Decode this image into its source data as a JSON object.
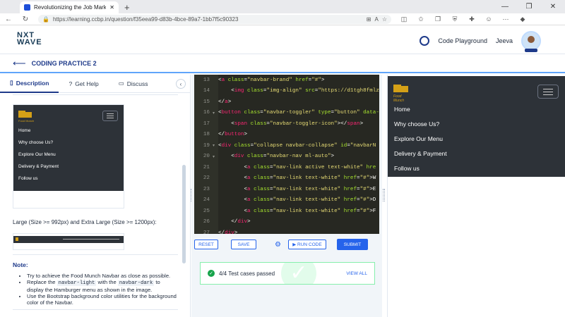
{
  "browser": {
    "tab_title": "Revolutionizing the Job Market |",
    "close_tab": "✕",
    "new_tab": "+",
    "url": "https://learning.ccbp.in/question/f35eea99-d83b-4bce-89a7-1bb7f5c90323",
    "window_controls": [
      "—",
      "❐",
      "✕"
    ]
  },
  "header": {
    "logo_line1": "NXT",
    "logo_line2": "WAVE",
    "code_playground": "Code Playground",
    "user_name": "Jeeva"
  },
  "subheader": {
    "title": "CODING PRACTICE 2"
  },
  "left_panel": {
    "tabs": [
      {
        "label": "Description"
      },
      {
        "label": "Get Help"
      },
      {
        "label": "Discuss"
      }
    ],
    "mock_nav": {
      "brand": "Food Munch",
      "links": [
        "Home",
        "Why choose Us?",
        "Explore Our Menu",
        "Delivery & Payment",
        "Follow us"
      ]
    },
    "large_text": "Large (Size >= 992px) and Extra Large (Size >= 1200px):",
    "note_heading": "Note:",
    "notes": {
      "n1": "Try to achieve the Food Munch Navbar as close as possible.",
      "n2_a": "Replace the",
      "n2_code1": "navbar-light",
      "n2_b": "with the",
      "n2_code2": "navbar-dark",
      "n2_c": "to display the Hamburger menu as shown in the image.",
      "n3": "Use the Bootstrap background color utilities for the background color of the Navbar."
    }
  },
  "editor": {
    "lines": [
      {
        "n": "13",
        "fold": "",
        "indent": "",
        "parts": [
          [
            "tk-txt",
            "<"
          ],
          [
            "tk-tag",
            "a "
          ],
          [
            "tk-attr",
            "class"
          ],
          [
            "tk-txt",
            "="
          ],
          [
            "tk-str",
            "\"navbar-brand\" "
          ],
          [
            "tk-attr",
            "href"
          ],
          [
            "tk-txt",
            "="
          ],
          [
            "tk-str",
            "\"#\""
          ],
          [
            "tk-txt",
            ">"
          ]
        ]
      },
      {
        "n": "14",
        "fold": "",
        "indent": "    ",
        "parts": [
          [
            "tk-txt",
            "<"
          ],
          [
            "tk-tag",
            "img "
          ],
          [
            "tk-attr",
            "class"
          ],
          [
            "tk-txt",
            "="
          ],
          [
            "tk-str",
            "\"img-align\" "
          ],
          [
            "tk-attr",
            "src"
          ],
          [
            "tk-txt",
            "="
          ],
          [
            "tk-str",
            "\"https://d1tgh8fmlz"
          ]
        ]
      },
      {
        "n": "15",
        "fold": "",
        "indent": "",
        "parts": [
          [
            "tk-txt",
            "</"
          ],
          [
            "tk-tag",
            "a"
          ],
          [
            "tk-txt",
            ">"
          ]
        ]
      },
      {
        "n": "16",
        "fold": "▾",
        "indent": "",
        "parts": [
          [
            "tk-txt",
            "<"
          ],
          [
            "tk-tag",
            "button "
          ],
          [
            "tk-attr",
            "class"
          ],
          [
            "tk-txt",
            "="
          ],
          [
            "tk-str",
            "\"navbar-toggler\" "
          ],
          [
            "tk-attr",
            "type"
          ],
          [
            "tk-txt",
            "="
          ],
          [
            "tk-str",
            "\"button\" "
          ],
          [
            "tk-attr",
            "data-"
          ]
        ]
      },
      {
        "n": "17",
        "fold": "",
        "indent": "    ",
        "parts": [
          [
            "tk-txt",
            "<"
          ],
          [
            "tk-tag",
            "span "
          ],
          [
            "tk-attr",
            "class"
          ],
          [
            "tk-txt",
            "="
          ],
          [
            "tk-str",
            "\"navbar-toggler-icon\""
          ],
          [
            "tk-txt",
            "></"
          ],
          [
            "tk-tag",
            "span"
          ],
          [
            "tk-txt",
            ">"
          ]
        ]
      },
      {
        "n": "18",
        "fold": "",
        "indent": "",
        "parts": [
          [
            "tk-txt",
            "</"
          ],
          [
            "tk-tag",
            "button"
          ],
          [
            "tk-txt",
            ">"
          ]
        ]
      },
      {
        "n": "19",
        "fold": "▾",
        "indent": "",
        "parts": [
          [
            "tk-txt",
            "<"
          ],
          [
            "tk-tag",
            "div "
          ],
          [
            "tk-attr",
            "class"
          ],
          [
            "tk-txt",
            "="
          ],
          [
            "tk-str",
            "\"collapse navbar-collapse\" "
          ],
          [
            "tk-attr",
            "id"
          ],
          [
            "tk-txt",
            "="
          ],
          [
            "tk-str",
            "\"navbarN"
          ]
        ]
      },
      {
        "n": "20",
        "fold": "▾",
        "indent": "    ",
        "parts": [
          [
            "tk-txt",
            "<"
          ],
          [
            "tk-tag",
            "div "
          ],
          [
            "tk-attr",
            "class"
          ],
          [
            "tk-txt",
            "="
          ],
          [
            "tk-str",
            "\"navbar-nav ml-auto\""
          ],
          [
            "tk-txt",
            ">"
          ]
        ]
      },
      {
        "n": "21",
        "fold": "",
        "indent": "        ",
        "parts": [
          [
            "tk-txt",
            "<"
          ],
          [
            "tk-tag",
            "a "
          ],
          [
            "tk-attr",
            "class"
          ],
          [
            "tk-txt",
            "="
          ],
          [
            "tk-str",
            "\"nav-link active text-white\" "
          ],
          [
            "tk-attr",
            "hre"
          ]
        ]
      },
      {
        "n": "22",
        "fold": "",
        "indent": "        ",
        "parts": [
          [
            "tk-txt",
            "<"
          ],
          [
            "tk-tag",
            "a "
          ],
          [
            "tk-attr",
            "class"
          ],
          [
            "tk-txt",
            "="
          ],
          [
            "tk-str",
            "\"nav-link text-white\" "
          ],
          [
            "tk-attr",
            "href"
          ],
          [
            "tk-txt",
            "="
          ],
          [
            "tk-str",
            "\"#\""
          ],
          [
            "tk-txt",
            ">W"
          ]
        ]
      },
      {
        "n": "23",
        "fold": "",
        "indent": "        ",
        "parts": [
          [
            "tk-txt",
            "<"
          ],
          [
            "tk-tag",
            "a "
          ],
          [
            "tk-attr",
            "class"
          ],
          [
            "tk-txt",
            "="
          ],
          [
            "tk-str",
            "\"nav-link text-white\" "
          ],
          [
            "tk-attr",
            "href"
          ],
          [
            "tk-txt",
            "="
          ],
          [
            "tk-str",
            "\"#\""
          ],
          [
            "tk-txt",
            ">E"
          ]
        ]
      },
      {
        "n": "24",
        "fold": "",
        "indent": "        ",
        "parts": [
          [
            "tk-txt",
            "<"
          ],
          [
            "tk-tag",
            "a "
          ],
          [
            "tk-attr",
            "class"
          ],
          [
            "tk-txt",
            "="
          ],
          [
            "tk-str",
            "\"nav-link text-white\" "
          ],
          [
            "tk-attr",
            "href"
          ],
          [
            "tk-txt",
            "="
          ],
          [
            "tk-str",
            "\"#\""
          ],
          [
            "tk-txt",
            ">D"
          ]
        ]
      },
      {
        "n": "25",
        "fold": "",
        "indent": "        ",
        "parts": [
          [
            "tk-txt",
            "<"
          ],
          [
            "tk-tag",
            "a "
          ],
          [
            "tk-attr",
            "class"
          ],
          [
            "tk-txt",
            "="
          ],
          [
            "tk-str",
            "\"nav-link text-white\" "
          ],
          [
            "tk-attr",
            "href"
          ],
          [
            "tk-txt",
            "="
          ],
          [
            "tk-str",
            "\"#\""
          ],
          [
            "tk-txt",
            ">F"
          ]
        ]
      },
      {
        "n": "26",
        "fold": "",
        "indent": "    ",
        "parts": [
          [
            "tk-txt",
            "</"
          ],
          [
            "tk-tag",
            "div"
          ],
          [
            "tk-txt",
            ">"
          ]
        ]
      },
      {
        "n": "27",
        "fold": "",
        "indent": "",
        "parts": [
          [
            "tk-txt",
            "</"
          ],
          [
            "tk-tag",
            "div"
          ],
          [
            "tk-txt",
            ">"
          ]
        ]
      }
    ],
    "buttons": {
      "reset": "RESET",
      "save": "SAVE",
      "run": "▶ RUN CODE",
      "submit": "SUBMIT"
    },
    "result": {
      "text": "4/4 Test cases passed",
      "view_all": "VIEW ALL"
    }
  },
  "preview": {
    "brand": "Food Munch",
    "links": [
      "Home",
      "Why choose Us?",
      "Explore Our Menu",
      "Delivery & Payment",
      "Follow us"
    ]
  },
  "colors": {
    "accent": "#2563eb",
    "navbar": "#2d3238",
    "brand_gold": "#d4a017",
    "success": "#16a34a"
  }
}
